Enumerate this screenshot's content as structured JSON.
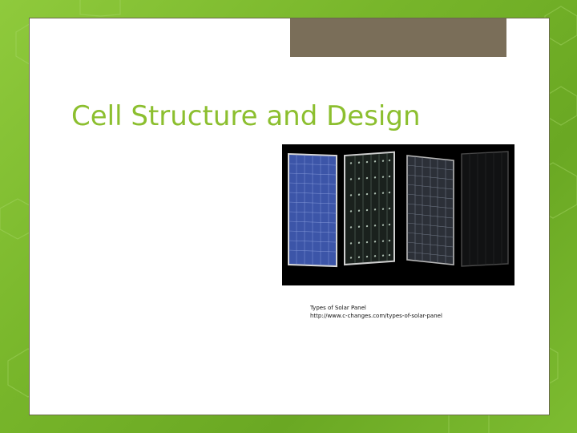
{
  "slide": {
    "title": "Cell Structure and Design"
  },
  "figure": {
    "image_icon": "solar-panels-photo",
    "caption_line1": "Types of Solar Panel",
    "caption_line2": "http://www.c-changes.com/types-of-solar-panel",
    "panels": [
      {
        "type": "polycrystalline",
        "color": "#3a4f9a"
      },
      {
        "type": "monocrystalline",
        "color": "#1a1f1c"
      },
      {
        "type": "monocrystalline-gray",
        "color": "#2a2d33"
      },
      {
        "type": "thin-film",
        "color": "#141414"
      }
    ]
  },
  "colors": {
    "background": "#7ab82c",
    "title": "#8cbf2f",
    "tab": "#7a6e59"
  }
}
